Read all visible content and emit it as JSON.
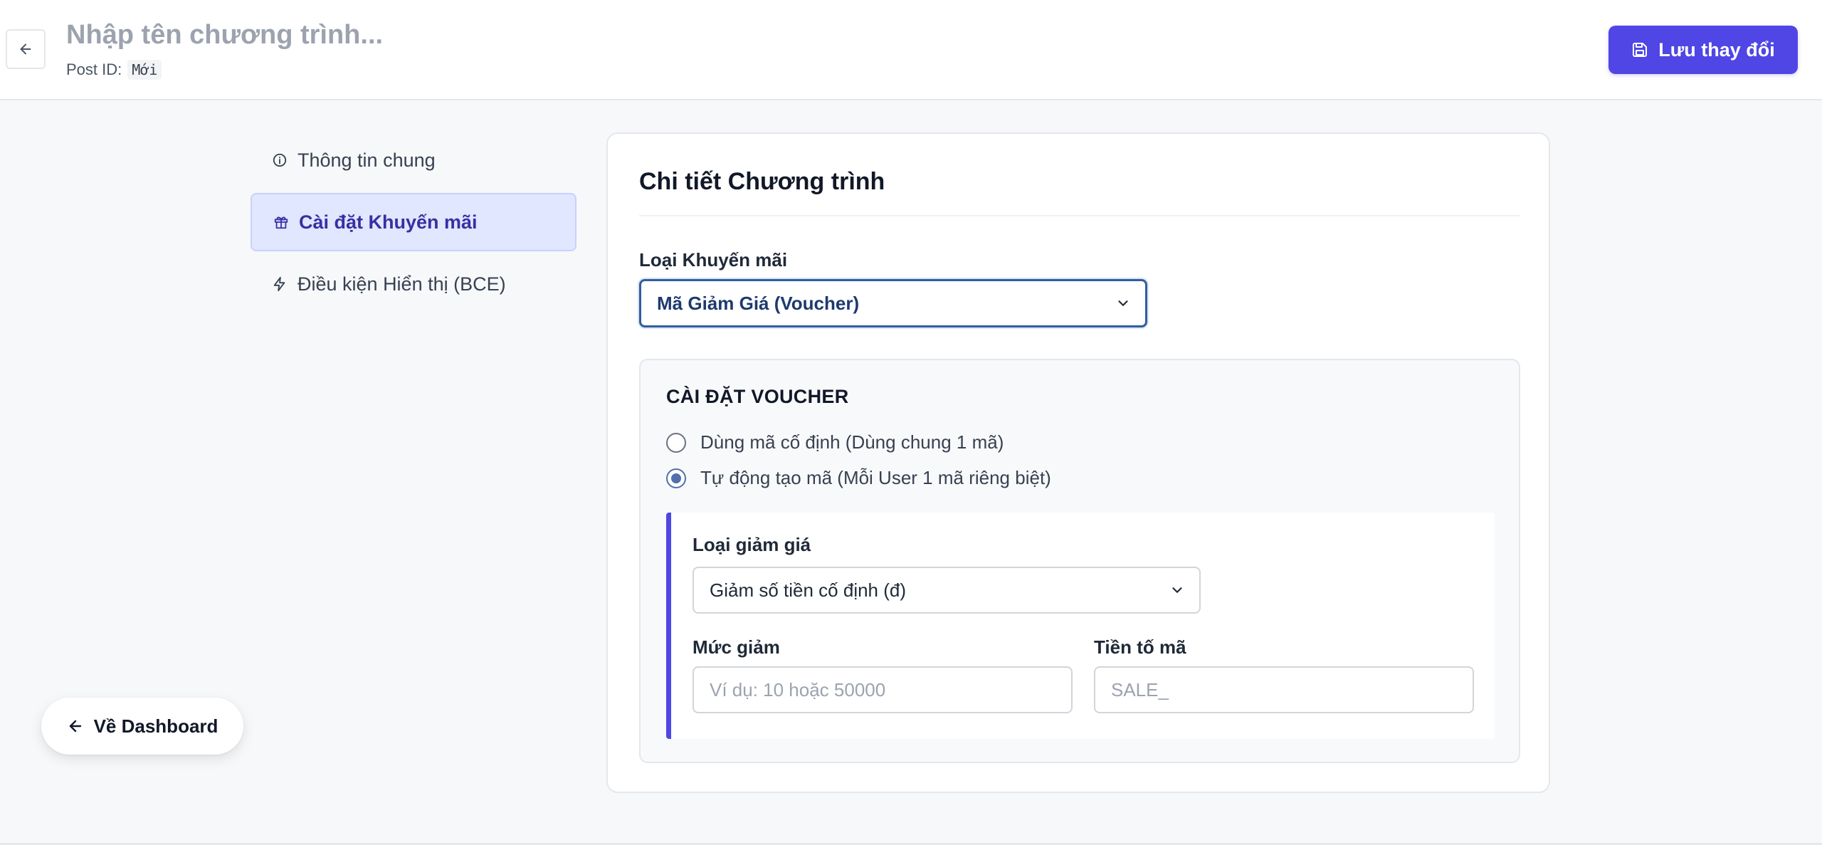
{
  "header": {
    "title_placeholder": "Nhập tên chương trình...",
    "post_id_label": "Post ID:",
    "post_id_value": "Mới",
    "save_label": "Lưu thay đổi"
  },
  "sidebar": {
    "items": [
      {
        "label": "Thông tin chung",
        "icon": "info-icon",
        "active": false
      },
      {
        "label": "Cài đặt Khuyến mãi",
        "icon": "gift-icon",
        "active": true
      },
      {
        "label": "Điều kiện Hiển thị (BCE)",
        "icon": "lightning-icon",
        "active": false
      }
    ]
  },
  "card": {
    "title": "Chi tiết Chương trình",
    "promo_type_label": "Loại Khuyến mãi",
    "promo_type_value": "Mã Giảm Giá (Voucher)",
    "voucher": {
      "title": "CÀI ĐẶT VOUCHER",
      "options": [
        {
          "label": "Dùng mã cố định (Dùng chung 1 mã)",
          "checked": false
        },
        {
          "label": "Tự động tạo mã (Mỗi User 1 mã riêng biệt)",
          "checked": true
        }
      ],
      "discount_type_label": "Loại giảm giá",
      "discount_type_value": "Giảm số tiền cố định (đ)",
      "amount_label": "Mức giảm",
      "amount_placeholder": "Ví dụ: 10 hoặc 50000",
      "prefix_label": "Tiền tố mã",
      "prefix_placeholder": "SALE_"
    }
  },
  "dashboard_button": {
    "label": "Về Dashboard"
  },
  "colors": {
    "accent": "#4f46e5",
    "active_bg": "#e0e7ff",
    "select_border": "#2f5f9e"
  }
}
